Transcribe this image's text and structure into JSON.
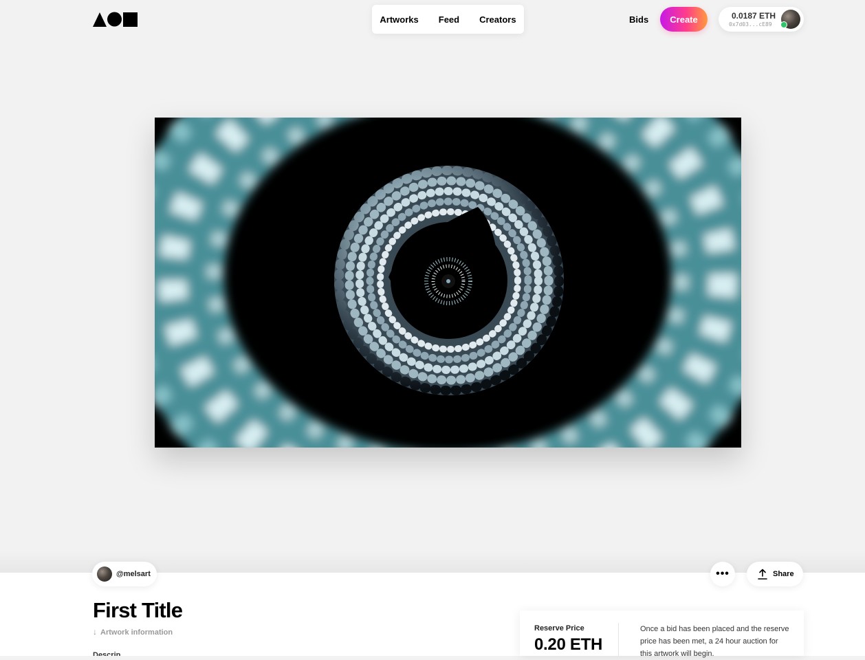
{
  "header": {
    "logo_alt": "",
    "nav": [
      "Artworks",
      "Feed",
      "Creators"
    ],
    "bids_label": "Bids",
    "create_label": "Create",
    "wallet": {
      "balance": "0.0187 ETH",
      "address": "0x7d03...cE89"
    }
  },
  "artwork": {
    "icon": "artwork-image"
  },
  "details": {
    "creator_handle": "@melsart",
    "more_icon": "more-dots-icon",
    "share_label": "Share",
    "title": "First Title",
    "artwork_info_link": "Artwork information",
    "description_peek": "Description",
    "reserve": {
      "label": "Reserve Price",
      "value": "0.20 ETH",
      "note": "Once a bid has been placed and the reserve price has been met, a 24 hour auction for this artwork will begin."
    }
  },
  "colors": {
    "accent_gradient": [
      "#c719e8",
      "#ff3d8b",
      "#ff9a3d"
    ],
    "online": "#2ec56a"
  }
}
